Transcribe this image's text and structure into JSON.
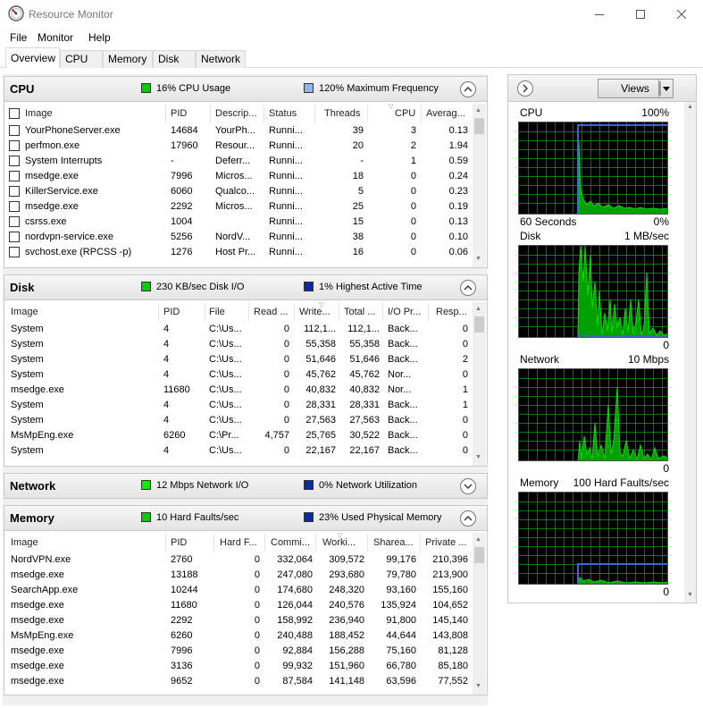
{
  "window": {
    "title": "Resource Monitor"
  },
  "menu": [
    "File",
    "Monitor",
    "Help"
  ],
  "tabs": [
    "Overview",
    "CPU",
    "Memory",
    "Disk",
    "Network"
  ],
  "cpu": {
    "title": "CPU",
    "indicator1": "16% CPU Usage",
    "indicator2": "120% Maximum Frequency",
    "columns": [
      "Image",
      "PID",
      "Descrip...",
      "Status",
      "Threads",
      "CPU",
      "Averag..."
    ],
    "rows": [
      [
        "YourPhoneServer.exe",
        "14684",
        "YourPh...",
        "Runni...",
        "39",
        "3",
        "0.13"
      ],
      [
        "perfmon.exe",
        "17960",
        "Resour...",
        "Runni...",
        "20",
        "2",
        "1.94"
      ],
      [
        "System Interrupts",
        "-",
        "Deferr...",
        "Runni...",
        "-",
        "1",
        "0.59"
      ],
      [
        "msedge.exe",
        "7996",
        "Micros...",
        "Runni...",
        "18",
        "0",
        "0.24"
      ],
      [
        "KillerService.exe",
        "6060",
        "Qualco...",
        "Runni...",
        "5",
        "0",
        "0.23"
      ],
      [
        "msedge.exe",
        "2292",
        "Micros...",
        "Runni...",
        "25",
        "0",
        "0.19"
      ],
      [
        "csrss.exe",
        "1004",
        "",
        "Runni...",
        "15",
        "0",
        "0.13"
      ],
      [
        "nordvpn-service.exe",
        "5256",
        "NordV...",
        "Runni...",
        "38",
        "0",
        "0.10"
      ],
      [
        "svchost.exe (RPCSS -p)",
        "1276",
        "Host Pr...",
        "Runni...",
        "16",
        "0",
        "0.06"
      ]
    ]
  },
  "disk": {
    "title": "Disk",
    "indicator1": "230 KB/sec Disk I/O",
    "indicator2": "1% Highest Active Time",
    "columns": [
      "Image",
      "PID",
      "File",
      "Read ...",
      "Write...",
      "Total ...",
      "I/O Pr...",
      "Resp..."
    ],
    "rows": [
      [
        "System",
        "4",
        "C:\\Us...",
        "0",
        "112,1...",
        "112,1...",
        "Back...",
        "0"
      ],
      [
        "System",
        "4",
        "C:\\Us...",
        "0",
        "55,358",
        "55,358",
        "Back...",
        "0"
      ],
      [
        "System",
        "4",
        "C:\\Us...",
        "0",
        "51,646",
        "51,646",
        "Back...",
        "2"
      ],
      [
        "System",
        "4",
        "C:\\Us...",
        "0",
        "45,762",
        "45,762",
        "Nor...",
        "0"
      ],
      [
        "msedge.exe",
        "11680",
        "C:\\Us...",
        "0",
        "40,832",
        "40,832",
        "Nor...",
        "1"
      ],
      [
        "System",
        "4",
        "C:\\Us...",
        "0",
        "28,331",
        "28,331",
        "Back...",
        "1"
      ],
      [
        "System",
        "4",
        "C:\\Us...",
        "0",
        "27,563",
        "27,563",
        "Back...",
        "0"
      ],
      [
        "MsMpEng.exe",
        "6260",
        "C:\\Pr...",
        "4,757",
        "25,765",
        "30,522",
        "Back...",
        "0"
      ],
      [
        "System",
        "4",
        "C:\\Us...",
        "0",
        "22,167",
        "22,167",
        "Back...",
        "0"
      ]
    ]
  },
  "network": {
    "title": "Network",
    "indicator1": "12 Mbps Network I/O",
    "indicator2": "0% Network Utilization"
  },
  "memory": {
    "title": "Memory",
    "indicator1": "10 Hard Faults/sec",
    "indicator2": "23% Used Physical Memory",
    "columns": [
      "Image",
      "PID",
      "Hard F...",
      "Commi...",
      "Worki...",
      "Sharea...",
      "Private ..."
    ],
    "rows": [
      [
        "NordVPN.exe",
        "2760",
        "0",
        "332,064",
        "309,572",
        "99,176",
        "210,396"
      ],
      [
        "msedge.exe",
        "13188",
        "0",
        "247,080",
        "293,680",
        "79,780",
        "213,900"
      ],
      [
        "SearchApp.exe",
        "10244",
        "0",
        "174,680",
        "248,320",
        "93,160",
        "155,160"
      ],
      [
        "msedge.exe",
        "11680",
        "0",
        "126,044",
        "240,576",
        "135,924",
        "104,652"
      ],
      [
        "msedge.exe",
        "2292",
        "0",
        "158,992",
        "236,940",
        "91,800",
        "145,140"
      ],
      [
        "MsMpEng.exe",
        "6260",
        "0",
        "240,488",
        "188,452",
        "44,644",
        "143,808"
      ],
      [
        "msedge.exe",
        "7996",
        "0",
        "92,884",
        "156,288",
        "75,160",
        "81,128"
      ],
      [
        "msedge.exe",
        "3136",
        "0",
        "99,932",
        "151,960",
        "66,780",
        "85,180"
      ],
      [
        "msedge.exe",
        "9652",
        "0",
        "87,584",
        "141,148",
        "63,596",
        "77,552"
      ]
    ]
  },
  "right": {
    "views_label": "Views",
    "graphs": [
      {
        "name": "CPU",
        "max": "100%",
        "min_left": "60 Seconds",
        "min_right": "0%"
      },
      {
        "name": "Disk",
        "max": "1 MB/sec",
        "min_left": "",
        "min_right": "0"
      },
      {
        "name": "Network",
        "max": "10 Mbps",
        "min_left": "",
        "min_right": "0"
      },
      {
        "name": "Memory",
        "max": "100 Hard Faults/sec",
        "min_left": "",
        "min_right": "0"
      }
    ]
  },
  "colors": {
    "accent_green": "#00cc00",
    "accent_blue": "#3c64dc",
    "graph_bg": "#000000",
    "grid": "#008000"
  },
  "icons": [
    "resource-monitor-app-icon",
    "minimize-icon",
    "maximize-icon",
    "close-icon",
    "chevron-up-icon",
    "chevron-down-icon",
    "chevron-right-icon",
    "dropdown-arrow-icon"
  ]
}
